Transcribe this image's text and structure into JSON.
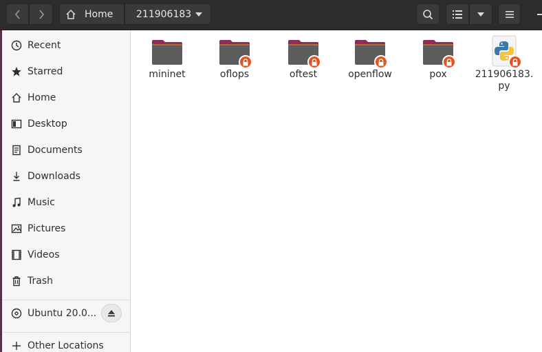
{
  "header": {
    "path": [
      {
        "label": "Home",
        "icon": "home-icon"
      },
      {
        "label": "211906183"
      }
    ]
  },
  "sidebar": {
    "items": [
      {
        "label": "Recent",
        "icon": "clock-icon"
      },
      {
        "label": "Starred",
        "icon": "star-icon"
      },
      {
        "label": "Home",
        "icon": "home-icon"
      },
      {
        "label": "Desktop",
        "icon": "desktop-icon"
      },
      {
        "label": "Documents",
        "icon": "document-icon"
      },
      {
        "label": "Downloads",
        "icon": "download-icon"
      },
      {
        "label": "Music",
        "icon": "music-icon"
      },
      {
        "label": "Pictures",
        "icon": "picture-icon"
      },
      {
        "label": "Videos",
        "icon": "video-icon"
      },
      {
        "label": "Trash",
        "icon": "trash-icon"
      }
    ],
    "devices": [
      {
        "label": "Ubuntu 20.0...",
        "icon": "disc-icon"
      }
    ],
    "other": {
      "label": "Other Locations",
      "icon": "plus-icon"
    }
  },
  "files": [
    {
      "name": "mininet",
      "type": "folder",
      "locked": false
    },
    {
      "name": "oflops",
      "type": "folder",
      "locked": true
    },
    {
      "name": "oftest",
      "type": "folder",
      "locked": true
    },
    {
      "name": "openflow",
      "type": "folder",
      "locked": true
    },
    {
      "name": "pox",
      "type": "folder",
      "locked": true
    },
    {
      "name": "211906183.\npy",
      "type": "python",
      "locked": true
    }
  ],
  "colors": {
    "folder_top": "#8e2b57",
    "folder_body": "#5d5d5d",
    "lock_badge": "#e4541f",
    "headerbar": "#2c2c2c"
  }
}
